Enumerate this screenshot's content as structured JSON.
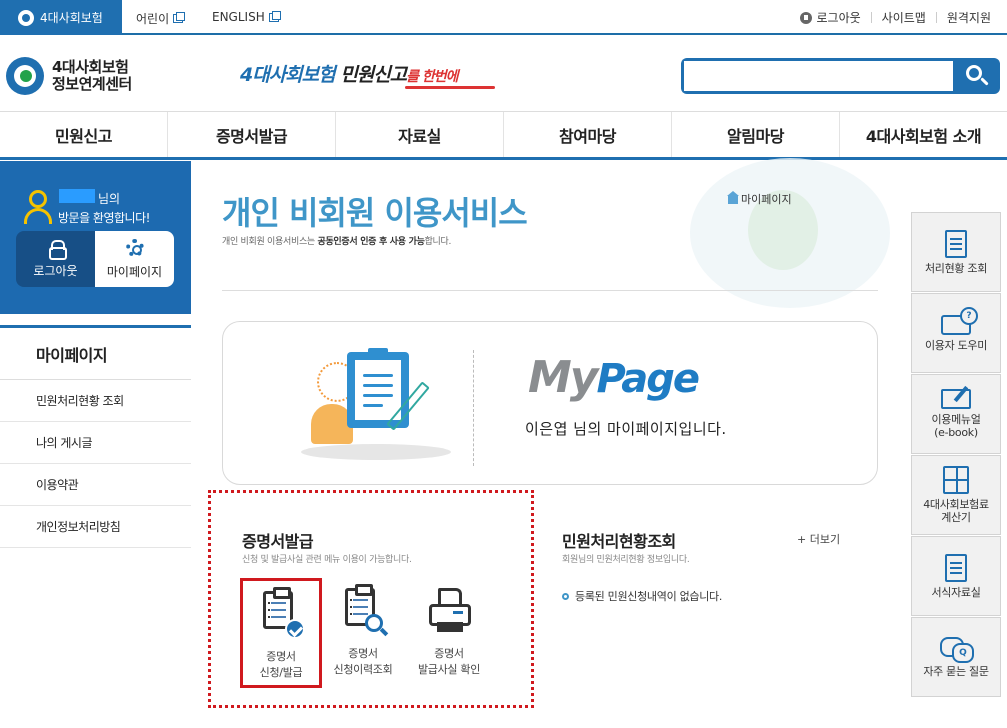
{
  "top_bar": {
    "site_tab": "4대사회보험",
    "kids_link": "어린이",
    "english_link": "ENGLISH",
    "logout": "로그아웃",
    "sitemap": "사이트맵",
    "remote_support": "원격지원"
  },
  "header": {
    "brand_line1": "4대사회보험",
    "brand_line2": "정보연계센터",
    "slogan_part1": "4대사회보험",
    "slogan_part2": " 민원신고",
    "slogan_part3": "를 한번에",
    "search_placeholder": ""
  },
  "gnb": [
    "민원신고",
    "증명서발급",
    "자료실",
    "참여마당",
    "알림마당",
    "4대사회보험 소개"
  ],
  "welcome": {
    "suffix": "님의",
    "message": "방문을 환영합니다!",
    "logout_label": "로그아웃",
    "mypage_label": "마이페이지"
  },
  "lnb": {
    "title": "마이페이지",
    "items": [
      "민원처리현황 조회",
      "나의 게시글",
      "이용약관",
      "개인정보처리방침"
    ]
  },
  "content": {
    "page_title": "개인 비회원 이용서비스",
    "desc_pre": "개인 비회원 이용서비스는 ",
    "desc_bold": "공동인증서 인증 후 사용 가능",
    "desc_post": "합니다.",
    "breadcrumb": "마이페이지",
    "logo_my": "My",
    "logo_page": "Page",
    "welcome_text": "이은엽 님의 마이페이지입니다."
  },
  "certificate": {
    "title": "증명서발급",
    "desc": "신청 및 발급사실 관련 메뉴 이용이 가능합니다.",
    "services": [
      {
        "line1": "증명서",
        "line2": "신청/발급"
      },
      {
        "line1": "증명서",
        "line2": "신청이력조회"
      },
      {
        "line1": "증명서",
        "line2": "발급사실 확인"
      }
    ]
  },
  "civil": {
    "title": "민원처리현황조회",
    "desc": "회원님의 민원처리현황 정보입니다.",
    "more": "+ 더보기",
    "empty_message": "등록된 민원신청내역이 없습니다."
  },
  "quick_menu": [
    {
      "label": "처리현황 조회",
      "icon": "document-list-icon"
    },
    {
      "label": "이용자 도우미",
      "icon": "monitor-help-icon"
    },
    {
      "label": "이용메뉴얼\n(e-book)",
      "icon": "ebook-icon"
    },
    {
      "label": "4대사회보험료\n계산기",
      "icon": "calculator-icon"
    },
    {
      "label": "서식자료실",
      "icon": "form-document-icon"
    },
    {
      "label": "자주 묻는 질문",
      "icon": "faq-chat-icon"
    }
  ],
  "colors": {
    "primary": "#1f6fb0",
    "title_blue": "#3f96c8",
    "highlight_red": "#d0191e",
    "welcome_bg": "#1d6ab0"
  }
}
